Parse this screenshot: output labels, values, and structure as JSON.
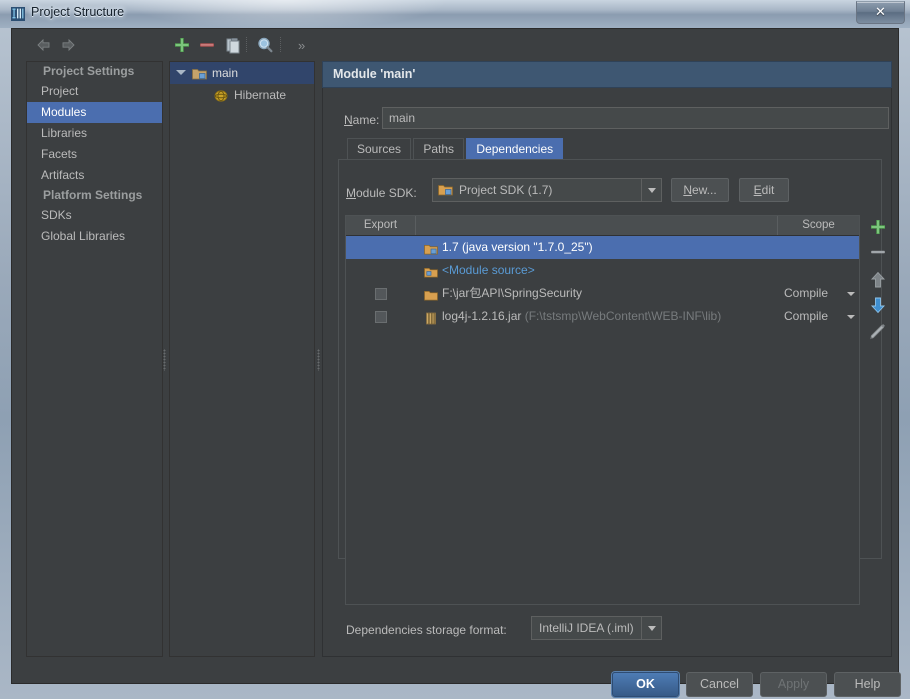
{
  "window": {
    "title": "Project Structure",
    "icon": "intellij-logo-icon",
    "close_label": "✕"
  },
  "toolbar": {
    "back_icon": "arrow-left-icon",
    "forward_icon": "arrow-right-icon",
    "add_icon": "plus-icon",
    "remove_icon": "minus-icon",
    "copy_icon": "copy-icon",
    "search_icon": "search-icon",
    "more_label": "»"
  },
  "sidebar": {
    "groups": [
      {
        "header": "Project Settings",
        "items": [
          {
            "label": "Project",
            "selected": false
          },
          {
            "label": "Modules",
            "selected": true
          },
          {
            "label": "Libraries",
            "selected": false
          },
          {
            "label": "Facets",
            "selected": false
          },
          {
            "label": "Artifacts",
            "selected": false
          }
        ]
      },
      {
        "header": "Platform Settings",
        "items": [
          {
            "label": "SDKs",
            "selected": false
          },
          {
            "label": "Global Libraries",
            "selected": false
          }
        ]
      }
    ]
  },
  "tree": {
    "nodes": [
      {
        "label": "main",
        "icon": "module-folder-icon",
        "selected": true,
        "expanded": true,
        "indent": 0
      },
      {
        "label": "Hibernate",
        "icon": "hibernate-facet-icon",
        "selected": false,
        "expanded": false,
        "indent": 1
      }
    ]
  },
  "content": {
    "header": "Module 'main'",
    "name_label": "Name:",
    "name_value": "main",
    "tabs": [
      {
        "label": "Sources",
        "active": false
      },
      {
        "label": "Paths",
        "active": false
      },
      {
        "label": "Dependencies",
        "active": true
      }
    ],
    "sdk_label": "Module SDK:",
    "sdk_value": "Project SDK (1.7)",
    "sdk_icon": "sdk-folder-icon",
    "new_button": "New...",
    "edit_button": "Edit",
    "storage_label": "Dependencies storage format:",
    "storage_value": "IntelliJ IDEA (.iml)"
  },
  "dependencies": {
    "columns": [
      "Export",
      "",
      "Scope"
    ],
    "rows": [
      {
        "export": null,
        "icon": "sdk-folder-icon",
        "name": "1.7 (java version \"1.7.0_25\")",
        "detail": "",
        "scope": "",
        "selected": true,
        "style": "normal"
      },
      {
        "export": null,
        "icon": "module-source-folder-icon",
        "name": "<Module source>",
        "detail": "",
        "scope": "",
        "selected": false,
        "style": "blue"
      },
      {
        "export": false,
        "icon": "folder-icon",
        "name": "F:\\jar包API\\SpringSecurity",
        "detail": "",
        "scope": "Compile",
        "selected": false,
        "style": "normal"
      },
      {
        "export": false,
        "icon": "jar-icon",
        "name": "log4j-1.2.16.jar",
        "detail": "(F:\\tstsmp\\WebContent\\WEB-INF\\lib)",
        "scope": "Compile",
        "selected": false,
        "style": "normal"
      }
    ],
    "tools": [
      {
        "icon": "plus-icon",
        "name": "add-dependency-button",
        "enabled": true
      },
      {
        "icon": "minus-icon",
        "name": "remove-dependency-button",
        "enabled": true
      },
      {
        "icon": "arrow-up-icon",
        "name": "move-up-button",
        "enabled": false
      },
      {
        "icon": "arrow-down-icon",
        "name": "move-down-button",
        "enabled": true
      },
      {
        "icon": "pencil-icon",
        "name": "edit-dependency-button",
        "enabled": true
      }
    ]
  },
  "footer": {
    "ok": "OK",
    "cancel": "Cancel",
    "apply": "Apply",
    "help": "Help"
  },
  "colors": {
    "accent": "#4b6eaf",
    "panel_bg": "#3c3f41",
    "header_bg": "#3e5772",
    "text": "#bbbbbb",
    "dim_text": "#777b7d",
    "link_blue": "#5a9bd5",
    "plus_green": "#4f9f4f",
    "minus_red": "#b05050"
  }
}
